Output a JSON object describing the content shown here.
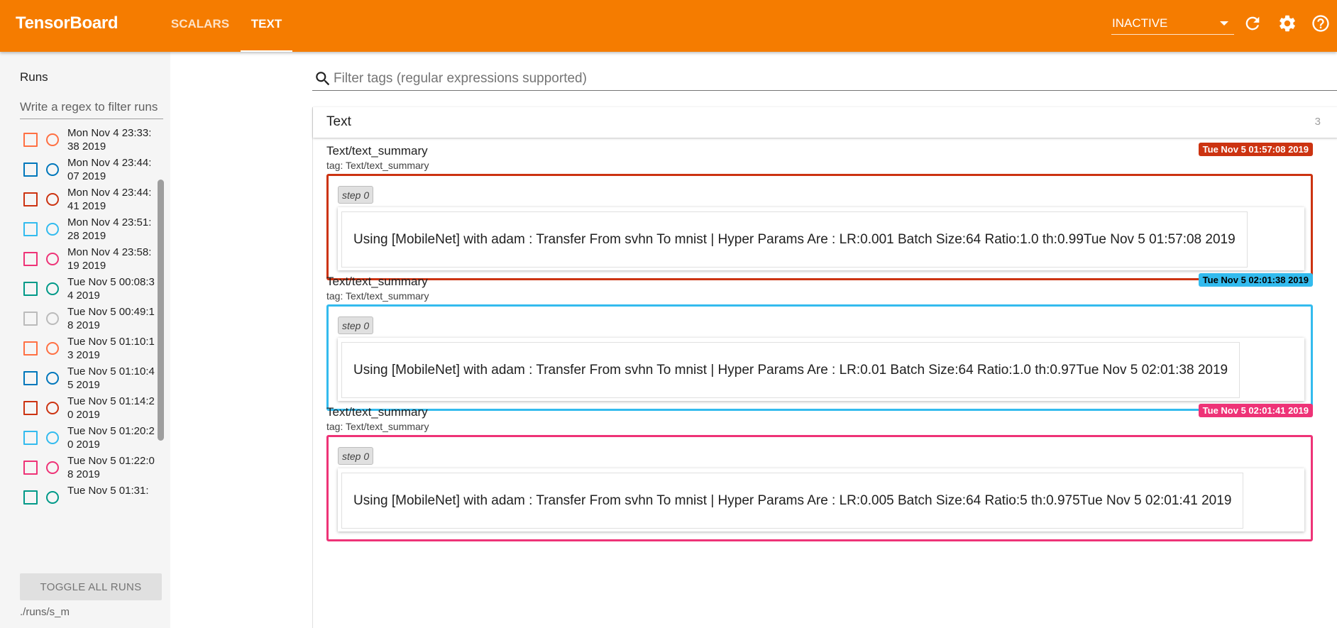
{
  "app": {
    "brand": "TensorBoard",
    "tabs": [
      {
        "label": "SCALARS",
        "active": false
      },
      {
        "label": "TEXT",
        "active": true
      }
    ],
    "reload": {
      "value": "INACTIVE"
    },
    "icons": [
      "refresh-icon",
      "settings-icon",
      "help-icon"
    ],
    "accent_color": "#f57c00"
  },
  "sidebar": {
    "title": "Runs",
    "filter_placeholder": "Write a regex to filter runs",
    "runs": [
      {
        "label": "Mon Nov 4 23:33:38 2019",
        "color": "#ff7043",
        "checked": false
      },
      {
        "label": "Mon Nov 4 23:44:07 2019",
        "color": "#0077bb",
        "checked": false
      },
      {
        "label": "Mon Nov 4 23:44:41 2019",
        "color": "#cc3311",
        "checked": false
      },
      {
        "label": "Mon Nov 4 23:51:28 2019",
        "color": "#33bbee",
        "checked": false
      },
      {
        "label": "Mon Nov 4 23:58:19 2019",
        "color": "#ee3377",
        "checked": false
      },
      {
        "label": "Tue Nov 5 00:08:34 2019",
        "color": "#009988",
        "checked": false
      },
      {
        "label": "Tue Nov 5 00:49:18 2019",
        "color": "#bbbbbb",
        "checked": false
      },
      {
        "label": "Tue Nov 5 01:10:13 2019",
        "color": "#ff7043",
        "checked": false
      },
      {
        "label": "Tue Nov 5 01:10:45 2019",
        "color": "#0077bb",
        "checked": false
      },
      {
        "label": "Tue Nov 5 01:14:20 2019",
        "color": "#cc3311",
        "checked": false
      },
      {
        "label": "Tue Nov 5 01:20:20 2019",
        "color": "#33bbee",
        "checked": false
      },
      {
        "label": "Tue Nov 5 01:22:08 2019",
        "color": "#ee3377",
        "checked": false
      },
      {
        "label": "Tue Nov 5 01:31:",
        "color": "#009988",
        "checked": false
      }
    ],
    "toggle_all_label": "TOGGLE ALL RUNS",
    "logdir": "./runs/s_m"
  },
  "main": {
    "tag_filter_placeholder": "Filter tags (regular expressions supported)",
    "category": {
      "title": "Text",
      "count": "3"
    },
    "cards": [
      {
        "title": "Text/text_summary",
        "tag": "tag: Text/text_summary",
        "run_badge": "Tue Nov 5 01:57:08 2019",
        "color": "#cc3311",
        "badge_text_color": "#ffffff",
        "step": "step 0",
        "text": "Using [MobileNet] with adam : Transfer From svhn To mnist | Hyper Params Are : LR:0.001 Batch Size:64 Ratio:1.0 th:0.99Tue Nov 5 01:57:08 2019"
      },
      {
        "title": "Text/text_summary",
        "tag": "tag: Text/text_summary",
        "run_badge": "Tue Nov 5 02:01:38 2019",
        "color": "#33bbee",
        "badge_text_color": "#000000",
        "step": "step 0",
        "text": "Using [MobileNet] with adam : Transfer From svhn To mnist | Hyper Params Are : LR:0.01 Batch Size:64 Ratio:1.0 th:0.97Tue Nov 5 02:01:38 2019"
      },
      {
        "title": "Text/text_summary",
        "tag": "tag: Text/text_summary",
        "run_badge": "Tue Nov 5 02:01:41 2019",
        "color": "#ee3377",
        "badge_text_color": "#ffffff",
        "step": "step 0",
        "text": "Using [MobileNet] with adam : Transfer From svhn To mnist | Hyper Params Are : LR:0.005 Batch Size:64 Ratio:5 th:0.975Tue Nov 5 02:01:41 2019"
      }
    ]
  }
}
